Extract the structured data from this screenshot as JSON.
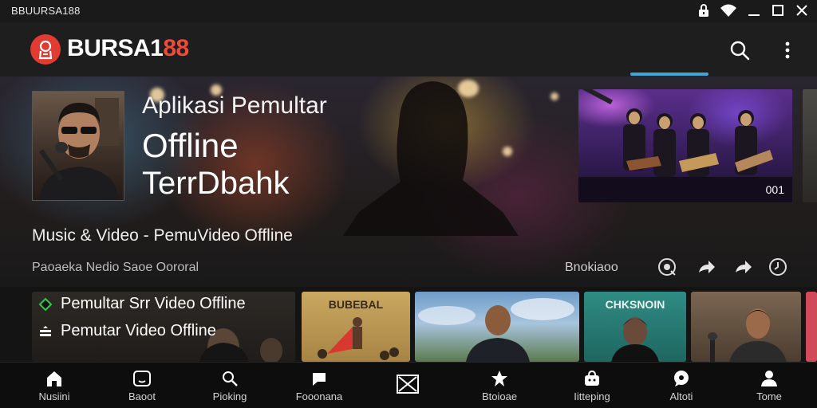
{
  "status_bar": {
    "title": "BBUURSA188",
    "icons": [
      "lock-icon",
      "wifi-icon",
      "minimize-icon",
      "maximize-icon",
      "close-icon"
    ]
  },
  "app_bar": {
    "name_main": "BURSA1",
    "name_accent": "88",
    "actions": [
      "search-icon",
      "more-vert-icon"
    ]
  },
  "hero": {
    "title_line1": "Aplikasi Pemultar",
    "title_line2": "Offline",
    "title_line3": "TerrDbahk",
    "right_badge": "001",
    "subtitle": "Music & Video - PemuVideo Offline",
    "meta": "Paoaeka Nedio Saoe Oororal",
    "action_label": "Bnokiaoo",
    "action_icons": [
      "explore-icon",
      "share-icon",
      "forward-icon",
      "timer-icon"
    ]
  },
  "list": {
    "items": [
      {
        "label": "Pemultar Srr Video Offline",
        "icon": "play-outline-icon"
      },
      {
        "label": "Pemutar Video Offline",
        "icon": "queue-icon"
      }
    ]
  },
  "cards": [
    {
      "caption": "BUBEBAL"
    },
    {
      "caption": ""
    },
    {
      "caption": "CHKSNOIN"
    },
    {
      "caption": ""
    }
  ],
  "bottom_nav": {
    "items": [
      {
        "label": "Nusiini",
        "icon": "home-icon"
      },
      {
        "label": "Baoot",
        "icon": "video-icon"
      },
      {
        "label": "Pioking",
        "icon": "search-icon"
      },
      {
        "label": "Fooonana",
        "icon": "chat-icon"
      },
      {
        "label": "Btoioae",
        "icon": "star-icon"
      },
      {
        "label": "Iitteping",
        "icon": "bag-icon"
      },
      {
        "label": "Altoti",
        "icon": "speech-icon"
      },
      {
        "label": "Tome",
        "icon": "person-icon"
      }
    ],
    "center_icon": "close-box-icon"
  },
  "colors": {
    "accent_red": "#e23b32",
    "tab_indicator": "#3fa6d8",
    "background": "#141414"
  }
}
